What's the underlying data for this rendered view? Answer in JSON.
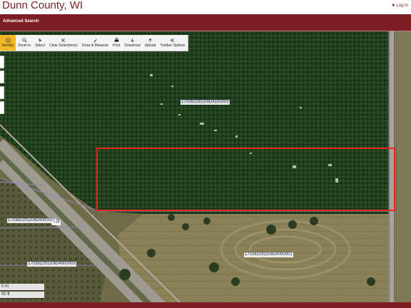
{
  "header": {
    "title": "Dunn County, WI",
    "login_label": "Log In",
    "login_icon": "person-icon"
  },
  "navbar": {
    "advanced_search_label": "Advanced Search"
  },
  "toolbar": {
    "items": [
      {
        "label": "Identify",
        "icon": "identify-icon",
        "active": true
      },
      {
        "label": "Zoom in",
        "icon": "zoom-in-icon"
      },
      {
        "label": "Select",
        "icon": "select-icon"
      },
      {
        "label": "Clear Selection(s)",
        "icon": "clear-icon"
      },
      {
        "label": "Draw & Measure",
        "icon": "draw-icon"
      },
      {
        "label": "Print",
        "icon": "print-icon"
      },
      {
        "label": "Download",
        "icon": "download-icon"
      },
      {
        "label": "Upload",
        "icon": "upload-icon"
      },
      {
        "label": "Toolbar Options",
        "icon": "chevrons-left-icon"
      }
    ],
    "active_color": "#f1b823"
  },
  "map": {
    "parcel_labels": [
      "17038229120824100003",
      "17038229120824000002",
      "17038229120824000003",
      "17038229120824000001"
    ],
    "road_label": "I-94",
    "selection_color": "#e8281c"
  },
  "scalebar": {
    "metric": "0 m",
    "imperial": "00 ft"
  },
  "colors": {
    "brand": "#7d1d24"
  }
}
